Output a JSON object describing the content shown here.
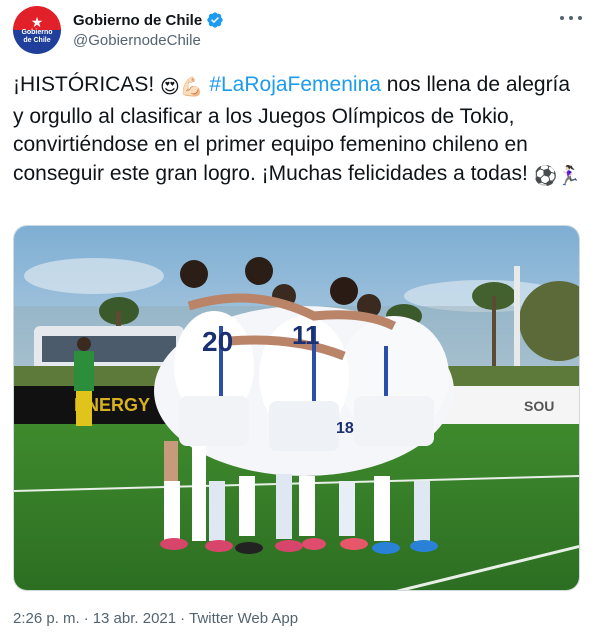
{
  "author": {
    "display_name": "Gobierno de Chile",
    "handle": "@GobiernodeChile",
    "avatar_text": "Gobierno de Chile",
    "verified_icon": "verified-badge-icon"
  },
  "tweet": {
    "text_part1": "¡HISTÓRICAS! ",
    "emoji1": "😍💪🏻",
    "hashtag": "#LaRojaFemenina",
    "text_part2": " nos llena de alegría y orgullo al clasificar a los Juegos Olímpicos de Tokio, convirtiéndose en el primer equipo femenino chileno en conseguir este gran logro. ¡Muchas felicidades a todas! ",
    "emoji2": "⚽️🏃🏻‍♀️",
    "photo_jersey_numbers": [
      "20",
      "11",
      "18"
    ],
    "photo_sign_text": [
      "ENERGY",
      "SOU"
    ]
  },
  "meta": {
    "time": "2:26 p. m.",
    "separator": "·",
    "date": "13 abr. 2021",
    "source": "Twitter Web App"
  },
  "colors": {
    "accent": "#1d9bf0",
    "secondary_text": "#536471"
  }
}
